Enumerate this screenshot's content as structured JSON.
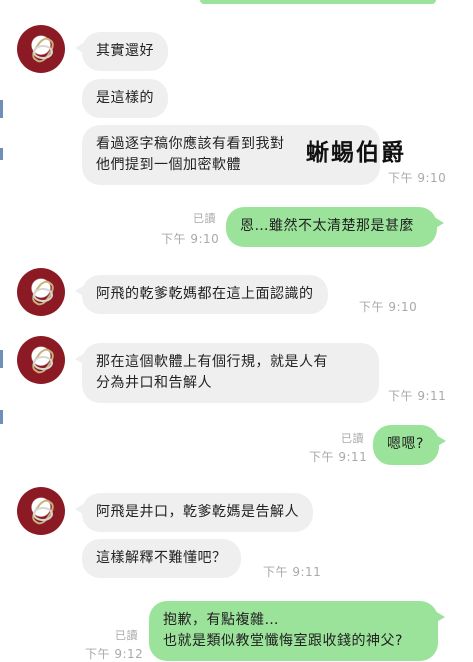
{
  "messages": [
    {
      "text": "其實還好"
    },
    {
      "text": "是這樣的"
    },
    {
      "lines": [
        "看過逐字稿你應該有看到我對",
        "他們提到一個加密軟體"
      ],
      "time": "下午 9:10"
    },
    {
      "text": "恩…雖然不太清楚那是甚麼",
      "read": "已讀",
      "time": "下午 9:10"
    },
    {
      "text": "阿飛的乾爹乾媽都在這上面認識的",
      "time": "下午 9:10"
    },
    {
      "lines": [
        "那在這個軟體上有個行規，就是人有",
        "分為井口和告解人"
      ],
      "time": "下午 9:11"
    },
    {
      "text": "嗯嗯?",
      "read": "已讀",
      "time": "下午 9:11"
    },
    {
      "text": "阿飛是井口，乾爹乾媽是告解人"
    },
    {
      "text": "這樣解釋不難懂吧？",
      "time": "下午 9:11"
    },
    {
      "lines": [
        "抱歉，有點複雜…",
        "也就是類似教堂懺悔室跟收錢的神父?"
      ],
      "read": "已讀",
      "time": "下午 9:12"
    }
  ],
  "overlay": {
    "text": "蜥蜴伯爵"
  },
  "colors": {
    "incoming_bubble": "#efefef",
    "outgoing_bubble": "#9be39a",
    "timestamp": "#a9a9a9"
  },
  "icons": {
    "avatar": "avatar-icon"
  }
}
